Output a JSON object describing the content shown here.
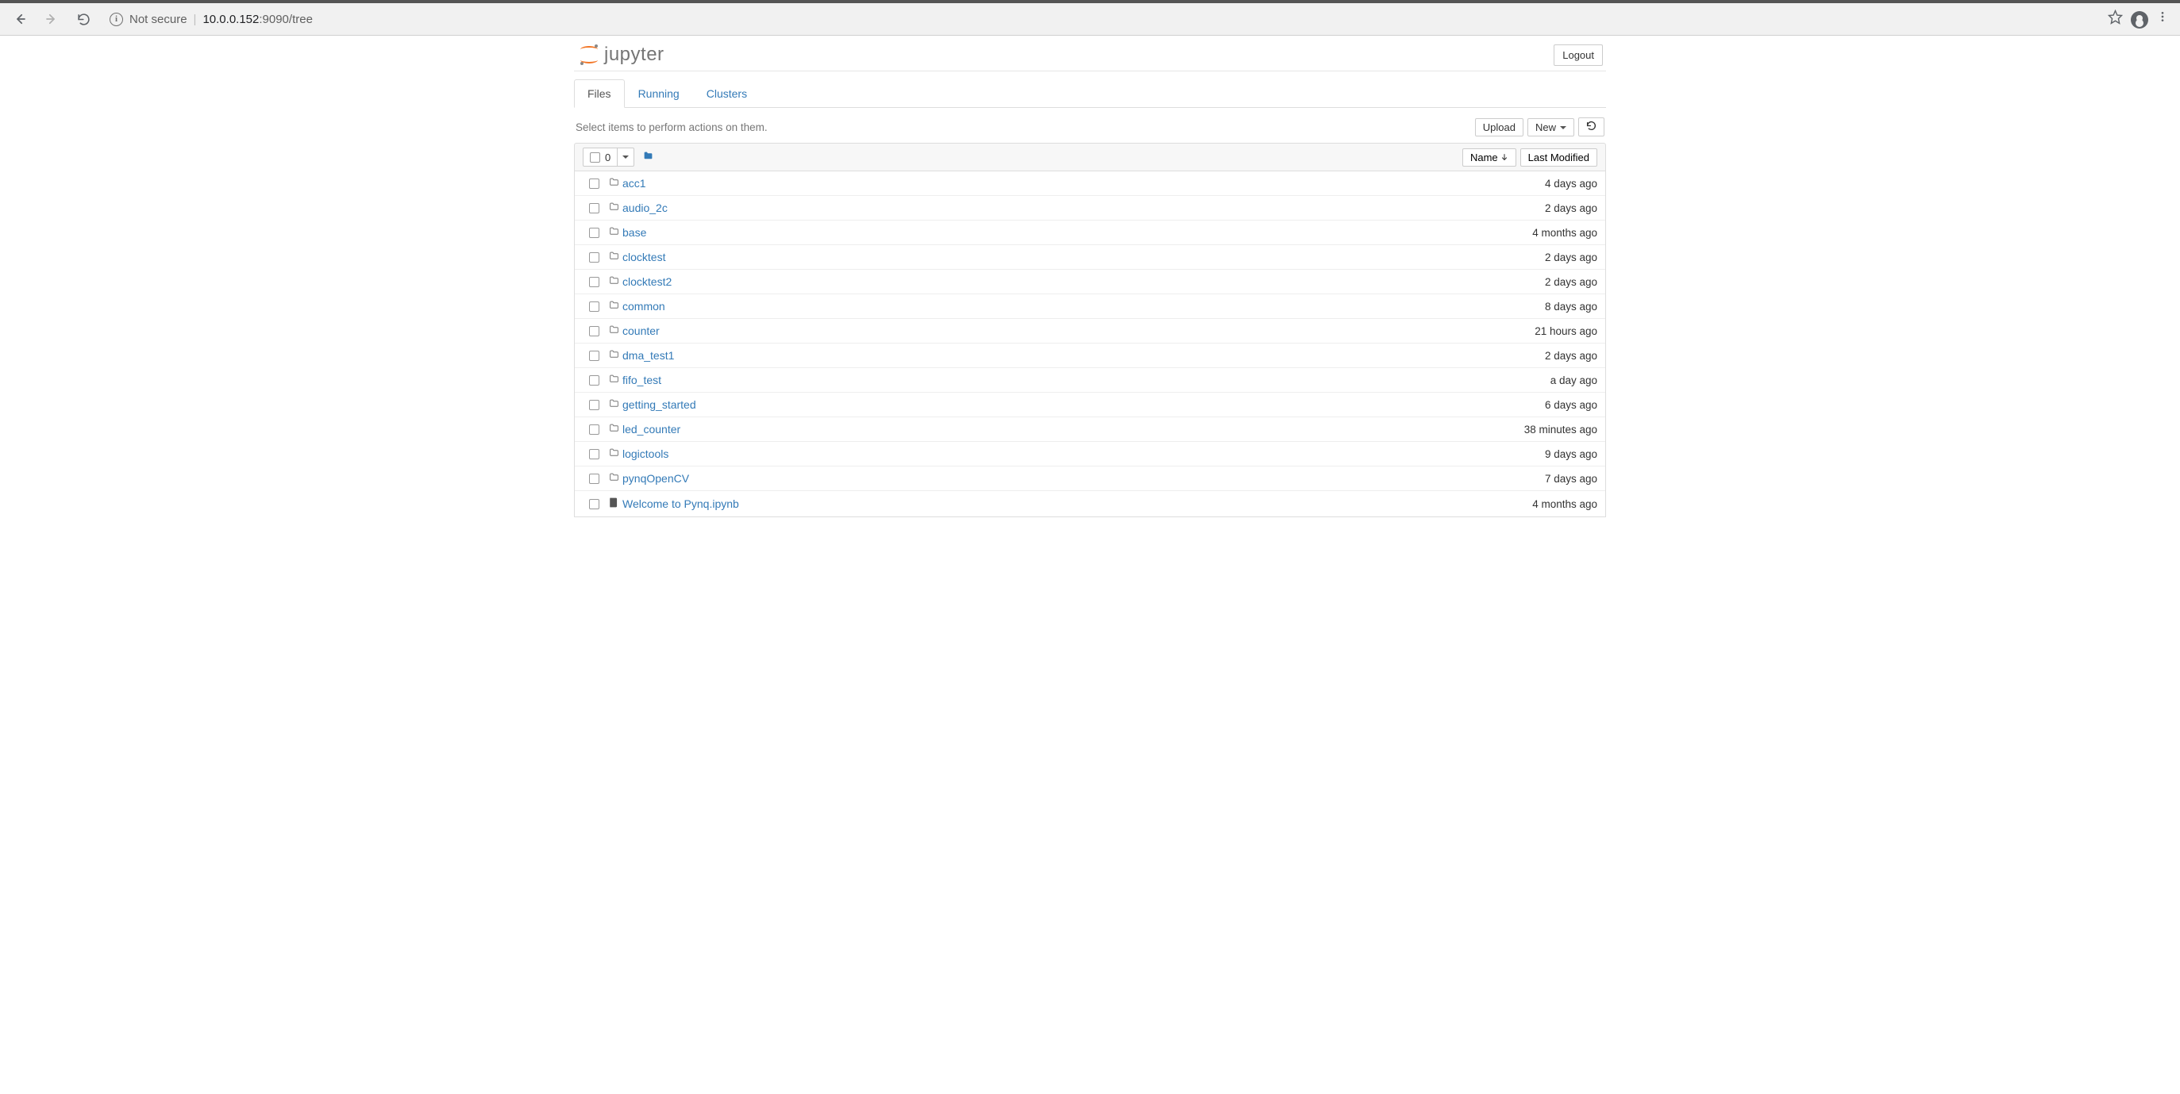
{
  "browser": {
    "security_text": "Not secure",
    "url_host": "10.0.0.152",
    "url_port_path": ":9090/tree"
  },
  "header": {
    "logo_text": "jupyter",
    "logout_label": "Logout"
  },
  "tabs": {
    "files": "Files",
    "running": "Running",
    "clusters": "Clusters"
  },
  "toolbar": {
    "hint": "Select items to perform actions on them.",
    "upload_label": "Upload",
    "new_label": "New"
  },
  "list_header": {
    "selected_count": "0",
    "name_label": "Name",
    "modified_label": "Last Modified"
  },
  "items": [
    {
      "type": "folder",
      "name": "acc1",
      "modified": "4 days ago"
    },
    {
      "type": "folder",
      "name": "audio_2c",
      "modified": "2 days ago"
    },
    {
      "type": "folder",
      "name": "base",
      "modified": "4 months ago"
    },
    {
      "type": "folder",
      "name": "clocktest",
      "modified": "2 days ago"
    },
    {
      "type": "folder",
      "name": "clocktest2",
      "modified": "2 days ago"
    },
    {
      "type": "folder",
      "name": "common",
      "modified": "8 days ago"
    },
    {
      "type": "folder",
      "name": "counter",
      "modified": "21 hours ago"
    },
    {
      "type": "folder",
      "name": "dma_test1",
      "modified": "2 days ago"
    },
    {
      "type": "folder",
      "name": "fifo_test",
      "modified": "a day ago"
    },
    {
      "type": "folder",
      "name": "getting_started",
      "modified": "6 days ago"
    },
    {
      "type": "folder",
      "name": "led_counter",
      "modified": "38 minutes ago"
    },
    {
      "type": "folder",
      "name": "logictools",
      "modified": "9 days ago"
    },
    {
      "type": "folder",
      "name": "pynqOpenCV",
      "modified": "7 days ago"
    },
    {
      "type": "notebook",
      "name": "Welcome to Pynq.ipynb",
      "modified": "4 months ago"
    }
  ]
}
